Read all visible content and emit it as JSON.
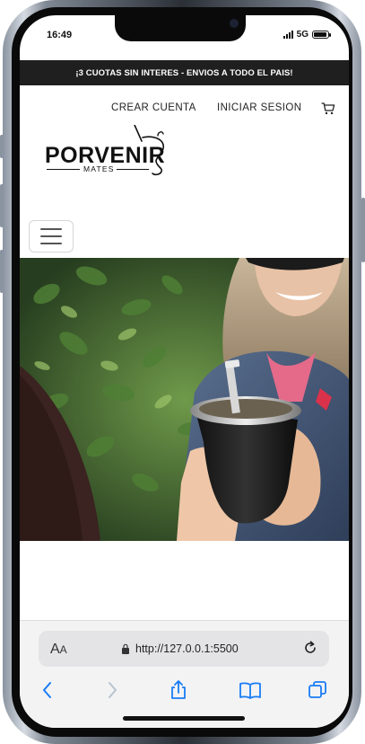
{
  "status_bar": {
    "time": "16:49",
    "network": "5G",
    "battery_level": 0.9
  },
  "promo": {
    "text": "¡3 CUOTAS SIN INTERES - ENVIOS A TODO EL PAIS!"
  },
  "nav": {
    "create_account": "CREAR CUENTA",
    "login": "INICIAR SESION",
    "cart_icon": "cart-icon"
  },
  "logo": {
    "word": "PORVENIR",
    "sub": "MATES"
  },
  "menu": {
    "icon": "hamburger-icon"
  },
  "hero": {
    "icon": "hero-photo"
  },
  "browser": {
    "text_size_label": "A",
    "text_size_small": "A",
    "url": "http://127.0.0.1:5500",
    "icons": [
      "back-icon",
      "forward-icon",
      "share-icon",
      "bookmarks-icon",
      "tabs-icon"
    ]
  },
  "colors": {
    "promo_bg": "#1f1f1f",
    "accent_blue": "#1a7cf5"
  }
}
